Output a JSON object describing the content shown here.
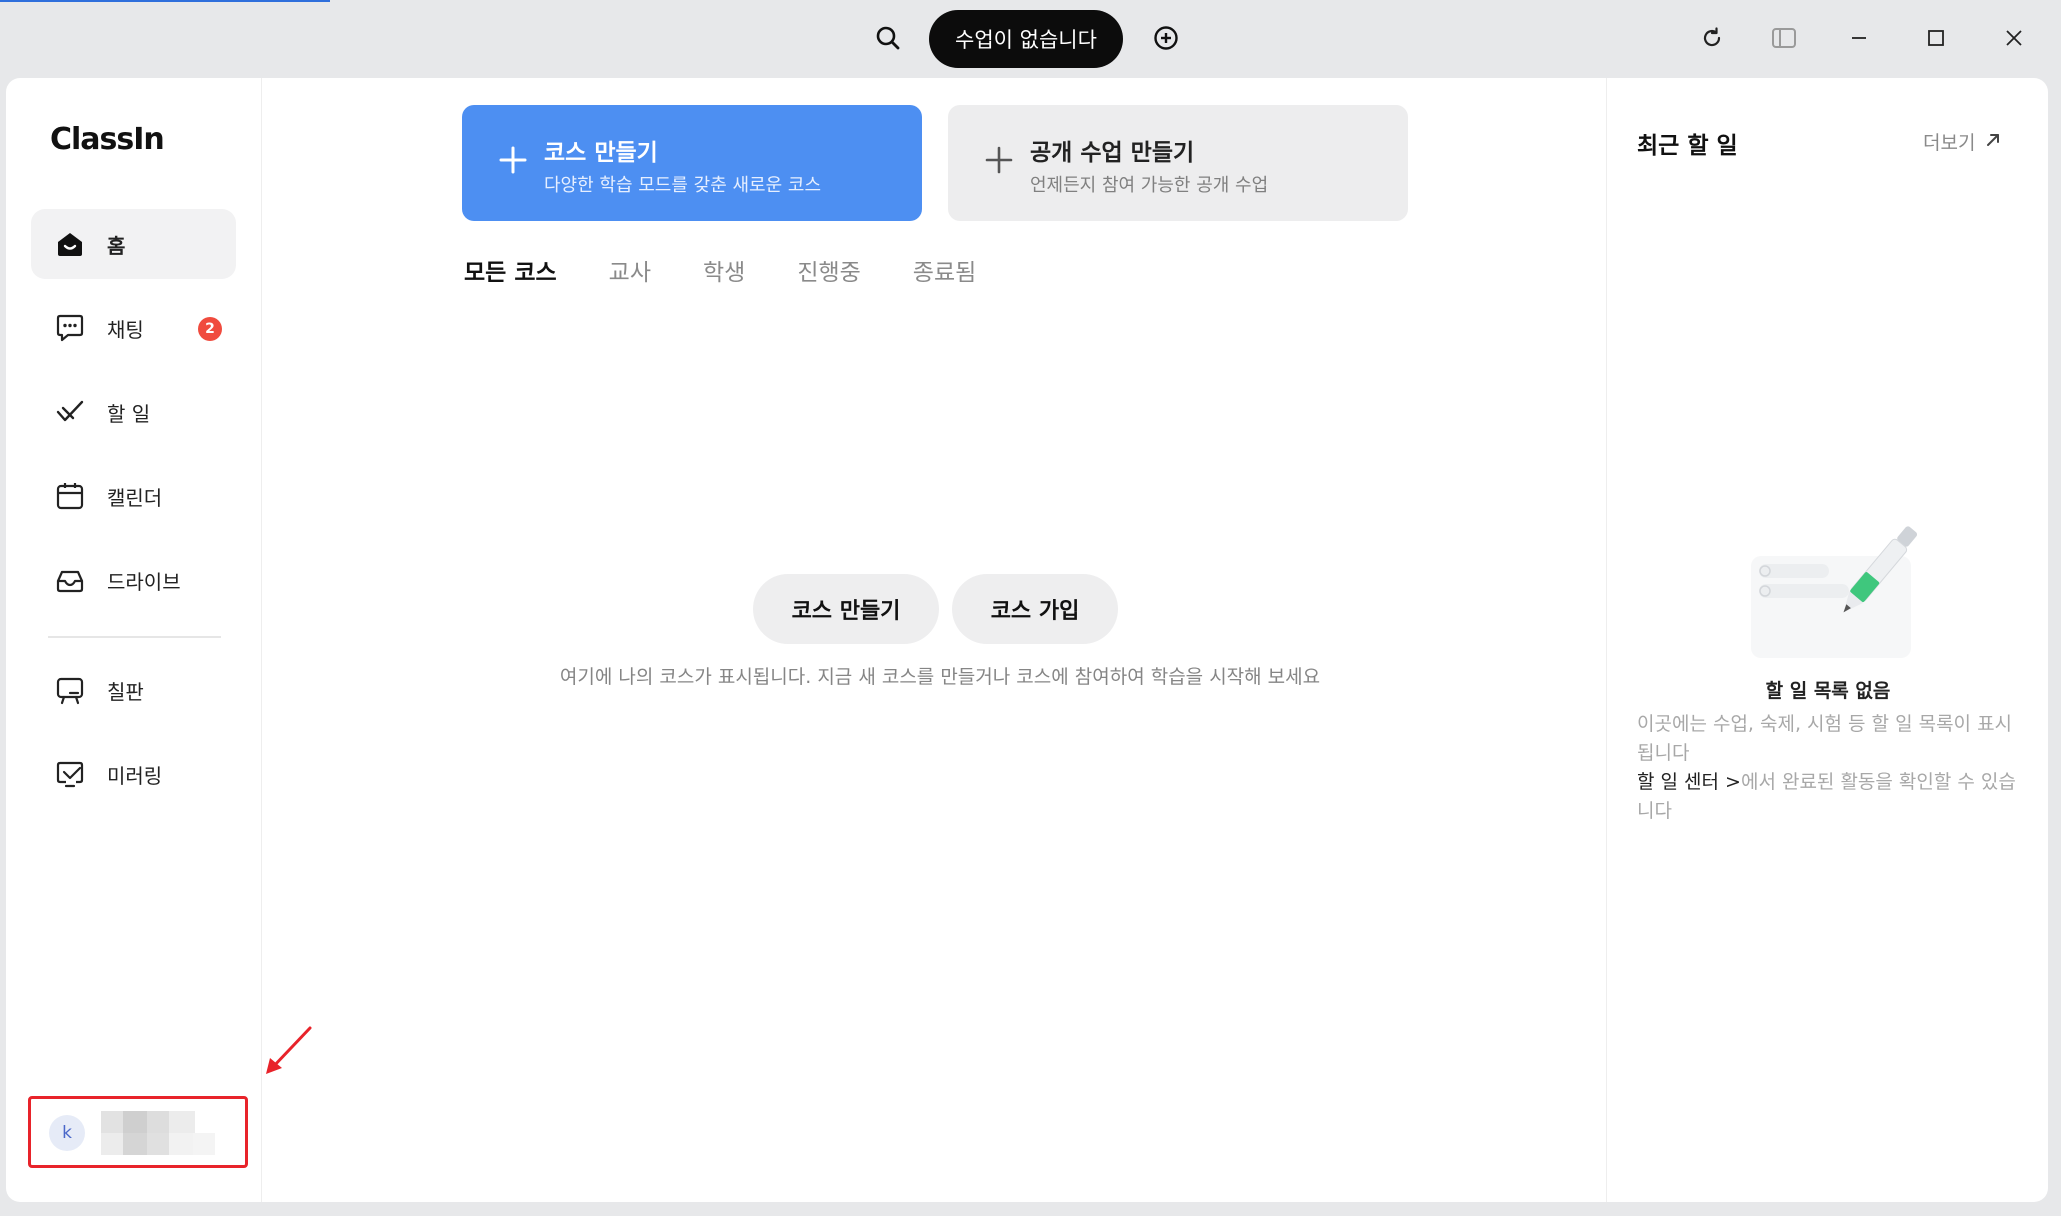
{
  "titlebar": {
    "class_status": "수업이 없습니다",
    "icons": [
      "search-icon",
      "add-circle-icon",
      "refresh-icon",
      "sidebar-toggle-icon",
      "minimize-icon",
      "maximize-icon",
      "close-icon"
    ]
  },
  "sidebar": {
    "logo": "ClassIn",
    "items": [
      {
        "label": "홈",
        "icon": "home-icon",
        "active": true
      },
      {
        "label": "채팅",
        "icon": "chat-icon",
        "badge": "2"
      },
      {
        "label": "할 일",
        "icon": "todo-icon"
      },
      {
        "label": "캘린더",
        "icon": "calendar-icon"
      },
      {
        "label": "드라이브",
        "icon": "drive-icon"
      },
      {
        "label": "칠판",
        "icon": "blackboard-icon"
      },
      {
        "label": "미러링",
        "icon": "mirroring-icon"
      }
    ],
    "profile": {
      "avatar_letter": "k"
    }
  },
  "main": {
    "create_course": {
      "title": "코스 만들기",
      "subtitle": "다양한 학습 모드를 갖춘 새로운 코스"
    },
    "create_public": {
      "title": "공개 수업 만들기",
      "subtitle": "언제든지 참여 가능한 공개 수업"
    },
    "tabs": [
      "모든 코스",
      "교사",
      "학생",
      "진행중",
      "종료됨"
    ],
    "empty": {
      "create_button": "코스 만들기",
      "join_button": "코스 가입",
      "hint": "여기에 나의 코스가 표시됩니다. 지금 새 코스를 만들거나 코스에 참여하여 학습을 시작해 보세요"
    }
  },
  "right_panel": {
    "title": "최근 할 일",
    "more": "더보기",
    "empty_title": "할 일 목록 없음",
    "empty_desc": "이곳에는 수업, 숙제, 시험 등 할 일 목록이 표시됩니다",
    "link_text": "할 일 센터",
    "link_suffix": "에서 완료된 활동을 확인할 수 있습니다"
  },
  "colors": {
    "accent_blue": "#4d8ff2",
    "badge_red": "#f04b3e",
    "annotation_red": "#e8232a"
  }
}
